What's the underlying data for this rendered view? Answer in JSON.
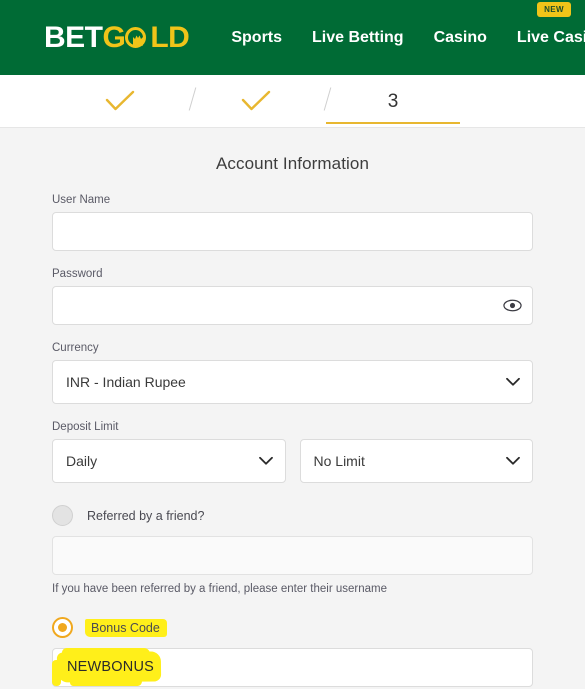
{
  "header": {
    "logo": {
      "part1": "BET",
      "part2": "G",
      "o_icon": "crown-in-circle-icon",
      "part3": "LD"
    },
    "nav": [
      {
        "label": "Sports",
        "name": "nav-sports"
      },
      {
        "label": "Live Betting",
        "name": "nav-live-betting"
      },
      {
        "label": "Casino",
        "name": "nav-casino"
      },
      {
        "label": "Live Casino",
        "name": "nav-live-casino"
      }
    ],
    "badge": "NEW",
    "colors": {
      "background": "#006b35",
      "logo_gold": "#f0c419",
      "badge_bg": "#f0c419",
      "badge_text": "#1d4d2b"
    }
  },
  "stepper": {
    "steps": [
      {
        "state": "complete",
        "icon": "check-icon",
        "label": ""
      },
      {
        "state": "complete",
        "icon": "check-icon",
        "label": ""
      },
      {
        "state": "active",
        "icon": "",
        "label": "3"
      }
    ],
    "separator": "/",
    "accent_color": "#e8b730"
  },
  "main": {
    "title": "Account Information",
    "fields": {
      "username": {
        "label": "User Name",
        "value": "",
        "placeholder": ""
      },
      "password": {
        "label": "Password",
        "value": "",
        "placeholder": "",
        "toggle_icon": "eye-icon"
      },
      "currency": {
        "label": "Currency",
        "value": "INR - Indian Rupee",
        "options": [
          "INR - Indian Rupee"
        ]
      },
      "deposit_limit": {
        "label": "Deposit Limit",
        "period": {
          "value": "Daily",
          "options": [
            "Daily"
          ]
        },
        "amount": {
          "value": "No Limit",
          "options": [
            "No Limit"
          ]
        }
      },
      "referred": {
        "radio_label": "Referred by a friend?",
        "selected": false,
        "value": "",
        "placeholder": "",
        "helper": "If you have been referred by a friend, please enter their username"
      },
      "bonus": {
        "radio_label": "Bonus Code",
        "selected": true,
        "value": "NEWBONUS",
        "placeholder": "",
        "highlighted": true,
        "highlight_color": "#ffef1a"
      }
    }
  }
}
